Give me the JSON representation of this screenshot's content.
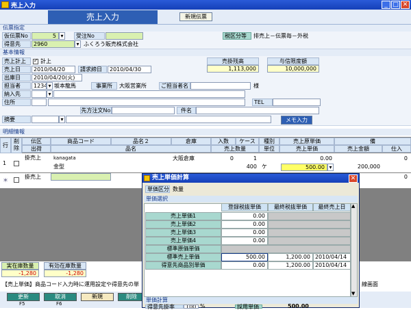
{
  "window": {
    "title": "売上入力",
    "minimize": "_",
    "maximize": "□",
    "close": "✕"
  },
  "header": {
    "title": "売上入力",
    "new_slip_button": "新規伝票"
  },
  "slip_section": {
    "title": "伝票指定",
    "temp_slip_no_label": "仮伝票No",
    "temp_slip_no": "5",
    "order_no_label": "受注No",
    "order_no": "",
    "tax_class_label": "税区分等",
    "tax_class_value": "排売上－伝票毎－外税",
    "customer_label": "得意先",
    "customer_code": "2960",
    "customer_name": "ふくろう販売株式会社"
  },
  "basic_section": {
    "title": "基本情報",
    "sales_post_label": "売上計上",
    "post_checkbox_label": "計上",
    "balance_label": "売掛残高",
    "balance_value": "1,113,000",
    "credit_limit_label": "与信限度額",
    "credit_limit_value": "10,000,000",
    "sales_date_label": "売上日",
    "sales_date": "2010/04/20",
    "billing_date_label": "請求締日",
    "billing_date": "2010/04/30",
    "ship_date_label": "出庫日",
    "ship_date": "2010/04/20(火)",
    "staff_label": "担当者",
    "staff_code": "1234",
    "staff_name": "坂本龍馬",
    "office_label": "事業所",
    "office_value": "大阪営業所",
    "contact_label": "ご担当者名",
    "contact_value": "",
    "honorific": "様",
    "delivery_label": "納入先",
    "address_label": "住所",
    "tel_label": "TEL",
    "client_order_label": "先方注文No",
    "subject_label": "件名",
    "summary_label": "摘要",
    "memo_button": "メモ入力"
  },
  "detail_section": {
    "title": "明細情報",
    "headers_row1": [
      "行No",
      "削除",
      "伝区",
      "商品コード",
      "品名２",
      "倉庫",
      "入数",
      "ケース",
      "種別",
      "売上原単価",
      "備"
    ],
    "headers_row2": [
      "出荷",
      "品名",
      "売上数量",
      "単位",
      "売上単価",
      "売上金額",
      "仕入"
    ],
    "rows": [
      {
        "no": "1",
        "slip_type": "掛売上",
        "product_code": "kanagata",
        "product_name": "金型",
        "warehouse": "大阪倉庫",
        "qty_per": "0",
        "cases": "1",
        "sales_qty": "400",
        "unit": "ケ",
        "cost_price": "0.00",
        "unit_price": "500.00",
        "amount": "200,000",
        "extra": "0"
      },
      {
        "no": "＊",
        "slip_type": "掛売上",
        "extra": "0"
      }
    ]
  },
  "stock": {
    "actual_label": "実在庫数量",
    "actual_value": "-1,280",
    "available_label": "有効在庫数量",
    "available_value": "-1,280"
  },
  "hint": {
    "text": "【売上単価】商品コード入力時に運用設定や得意先の単",
    "text_right": "線画面"
  },
  "footer": {
    "update_button": "更新",
    "update_key": "F5",
    "cancel_button": "取消",
    "cancel_key": "F6",
    "new_button": "新規",
    "delete_button": "削除"
  },
  "dialog": {
    "title": "売上単価計算",
    "unit_class_label": "単価区分",
    "unit_class_value": "数量",
    "select_section": "単価選択",
    "col_headers": [
      "登録税抜単価",
      "最終税抜単価",
      "最終売上日"
    ],
    "rows": [
      {
        "label": "売上単価1",
        "registered": "0.00",
        "last": "",
        "date": ""
      },
      {
        "label": "売上単価2",
        "registered": "0.00",
        "last": "",
        "date": ""
      },
      {
        "label": "売上単価3",
        "registered": "0.00",
        "last": "",
        "date": ""
      },
      {
        "label": "売上単価4",
        "registered": "0.00",
        "last": "",
        "date": ""
      },
      {
        "label": "標準原価単価",
        "registered": "",
        "last": "",
        "date": ""
      },
      {
        "label": "標準売上単価",
        "registered": "500.00",
        "last": "1,200.00",
        "date": "2010/04/14"
      },
      {
        "label": "得意先商品別単価",
        "registered": "0.00",
        "last": "1,200.00",
        "date": "2010/04/14"
      }
    ],
    "calc_section": "単価計算",
    "rate_label": "得意先掛率",
    "rate_value": "100",
    "rate_unit": "%",
    "adopted_label": "採用単価",
    "adopted_value": "500.00"
  }
}
